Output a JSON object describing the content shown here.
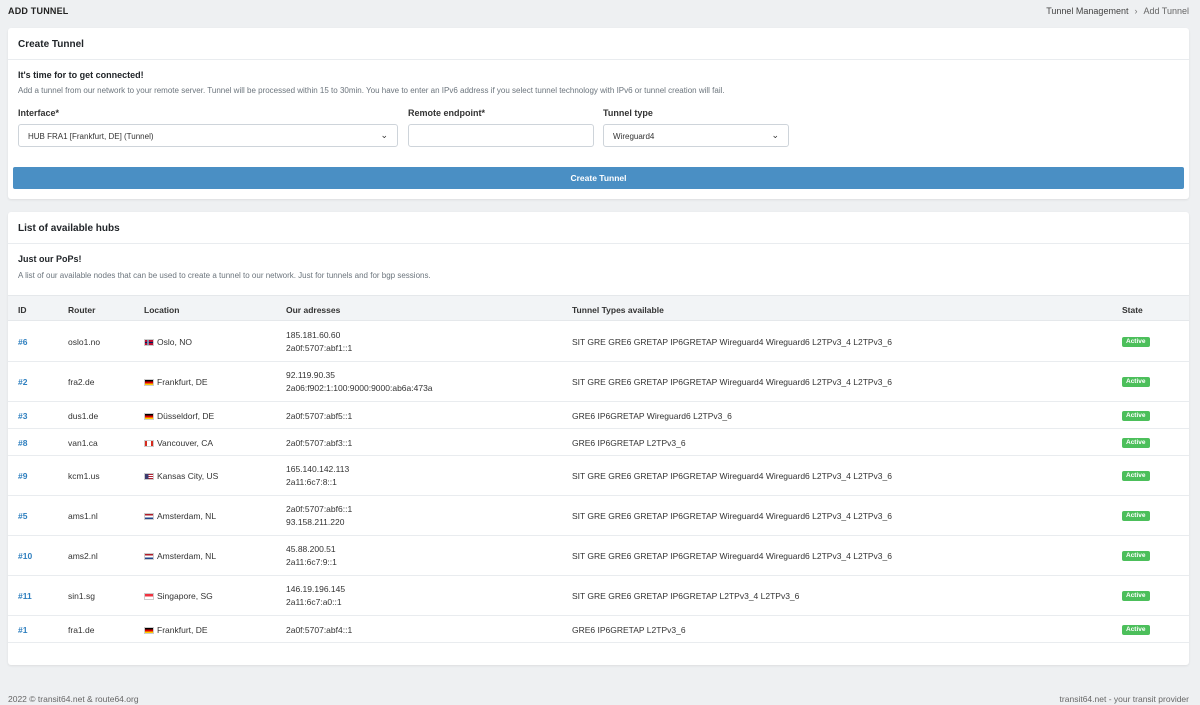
{
  "header": {
    "title": "ADD TUNNEL",
    "breadcrumb": [
      "Tunnel Management",
      "Add Tunnel"
    ]
  },
  "create_card": {
    "title": "Create Tunnel",
    "heading": "It's time for to get connected!",
    "description": "Add a tunnel from our network to your remote server. Tunnel will be processed within 15 to 30min. You have to enter an IPv6 address if you select tunnel technology with IPv6 or tunnel creation will fail.",
    "interface_label": "Interface*",
    "interface_value": "HUB FRA1 [Frankfurt, DE] (Tunnel)",
    "endpoint_label": "Remote endpoint*",
    "endpoint_value": "",
    "type_label": "Tunnel type",
    "type_value": "Wireguard4",
    "button_label": "Create Tunnel"
  },
  "list_card": {
    "title": "List of available hubs",
    "heading": "Just our PoPs!",
    "description": "A list of our available nodes that can be used to create a tunnel to our network. Just for tunnels and for bgp sessions.",
    "columns": [
      "ID",
      "Router",
      "Location",
      "Our adresses",
      "Tunnel Types available",
      "State"
    ],
    "rows": [
      {
        "id": "#6",
        "router": "oslo1.no",
        "flag": "no",
        "location": "Oslo, NO",
        "addr1": "185.181.60.60",
        "addr2": "2a0f:5707:abf1::1",
        "types": "SIT GRE GRE6 GRETAP IP6GRETAP Wireguard4 Wireguard6 L2TPv3_4 L2TPv3_6",
        "state": "Active"
      },
      {
        "id": "#2",
        "router": "fra2.de",
        "flag": "de",
        "location": "Frankfurt, DE",
        "addr1": "92.119.90.35",
        "addr2": "2a06:f902:1:100:9000:9000:ab6a:473a",
        "types": "SIT GRE GRE6 GRETAP IP6GRETAP Wireguard4 Wireguard6 L2TPv3_4 L2TPv3_6",
        "state": "Active"
      },
      {
        "id": "#3",
        "router": "dus1.de",
        "flag": "de",
        "location": "Düsseldorf, DE",
        "addr1": "2a0f:5707:abf5::1",
        "addr2": "",
        "types": "GRE6 IP6GRETAP Wireguard6 L2TPv3_6",
        "state": "Active"
      },
      {
        "id": "#8",
        "router": "van1.ca",
        "flag": "ca",
        "location": "Vancouver, CA",
        "addr1": "2a0f:5707:abf3::1",
        "addr2": "",
        "types": "GRE6 IP6GRETAP L2TPv3_6",
        "state": "Active"
      },
      {
        "id": "#9",
        "router": "kcm1.us",
        "flag": "us",
        "location": "Kansas City, US",
        "addr1": "165.140.142.113",
        "addr2": "2a11:6c7:8::1",
        "types": "SIT GRE GRE6 GRETAP IP6GRETAP Wireguard4 Wireguard6 L2TPv3_4 L2TPv3_6",
        "state": "Active"
      },
      {
        "id": "#5",
        "router": "ams1.nl",
        "flag": "nl",
        "location": "Amsterdam, NL",
        "addr1": "2a0f:5707:abf6::1",
        "addr2": "93.158.211.220",
        "types": "SIT GRE GRE6 GRETAP IP6GRETAP Wireguard4 Wireguard6 L2TPv3_4 L2TPv3_6",
        "state": "Active"
      },
      {
        "id": "#10",
        "router": "ams2.nl",
        "flag": "nl",
        "location": "Amsterdam, NL",
        "addr1": "45.88.200.51",
        "addr2": "2a11:6c7:9::1",
        "types": "SIT GRE GRE6 GRETAP IP6GRETAP Wireguard4 Wireguard6 L2TPv3_4 L2TPv3_6",
        "state": "Active"
      },
      {
        "id": "#11",
        "router": "sin1.sg",
        "flag": "sg",
        "location": "Singapore, SG",
        "addr1": "146.19.196.145",
        "addr2": "2a11:6c7:a0::1",
        "types": "SIT GRE GRE6 GRETAP IP6GRETAP L2TPv3_4 L2TPv3_6",
        "state": "Active"
      },
      {
        "id": "#1",
        "router": "fra1.de",
        "flag": "de",
        "location": "Frankfurt, DE",
        "addr1": "2a0f:5707:abf4::1",
        "addr2": "",
        "types": "GRE6 IP6GRETAP L2TPv3_6",
        "state": "Active"
      }
    ]
  },
  "footer": {
    "left": "2022 © transit64.net & route64.org",
    "right": "transit64.net - your transit provider"
  },
  "colors": {
    "accent": "#4a8fc4",
    "link": "#2e7fbf",
    "active_badge": "#4cbf5b"
  }
}
